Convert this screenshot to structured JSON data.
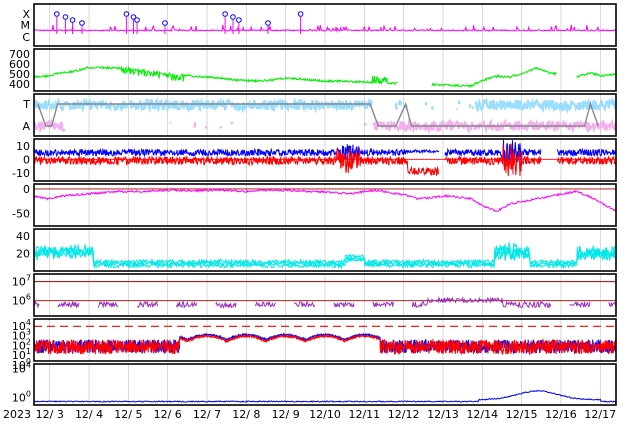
{
  "year_label": "2023",
  "x_dates": [
    "12/ 3",
    "12/ 4",
    "12/ 5",
    "12/ 6",
    "12/ 7",
    "12/ 8",
    "12/ 9",
    "12/10",
    "12/11",
    "12/12",
    "12/13",
    "12/14",
    "12/15",
    "12/16",
    "12/17"
  ],
  "colors": {
    "magenta": "#ff00ff",
    "green": "#00ee00",
    "lightblue": "#99ddff",
    "pink": "#f4b0ee",
    "gray": "#888888",
    "blue": "#0000ff",
    "red": "#ff0000",
    "purple": "#9b30b8",
    "cyan": "#00e8e8",
    "darkred": "#aa0000",
    "grid": "#c0c0c0"
  },
  "chart_data": [
    {
      "type": "line",
      "id": "xray-flare-class",
      "ytick_labels": [
        "X",
        "M",
        "C"
      ],
      "series": [
        {
          "color": "magenta"
        }
      ],
      "flare_markers": [
        3.18,
        3.4,
        3.58,
        3.82,
        4.95,
        5.13,
        5.22,
        5.93,
        7.46,
        7.66,
        7.81,
        8.55,
        9.38
      ]
    },
    {
      "type": "line",
      "id": "solar-wind-speed",
      "yticks": [
        400,
        500,
        600,
        700
      ],
      "ytick_labels": [
        "400",
        "500",
        "600",
        "700"
      ],
      "ylim": [
        330,
        750
      ],
      "series": [
        {
          "color": "green",
          "values": [
            470,
            480,
            510,
            525,
            560,
            565,
            560,
            555,
            540,
            520,
            505,
            490,
            480,
            470,
            460,
            445,
            435,
            430,
            440,
            460,
            450,
            440,
            430,
            430,
            425,
            420,
            415,
            410,
            405,
            400,
            395,
            390,
            385,
            380,
            440,
            480,
            470,
            510,
            560,
            510,
            490,
            470,
            510,
            480,
            500
          ]
        }
      ]
    },
    {
      "type": "line",
      "id": "imf-sector",
      "ytick_labels": [
        "T",
        "A"
      ],
      "series": [
        {
          "color": "lightblue"
        },
        {
          "color": "pink"
        },
        {
          "color": "gray"
        }
      ]
    },
    {
      "type": "line",
      "id": "imf-field",
      "yticks": [
        -10,
        0,
        10
      ],
      "ytick_labels": [
        "-10",
        "0",
        "10"
      ],
      "ylim": [
        -16,
        15
      ],
      "series": [
        {
          "color": "blue"
        },
        {
          "color": "red"
        }
      ]
    },
    {
      "type": "line",
      "id": "dst-index",
      "yticks": [
        -50,
        0
      ],
      "ytick_labels": [
        "-50",
        "0"
      ],
      "ylim": [
        -75,
        10
      ],
      "series": [
        {
          "color": "magenta",
          "values": [
            -15,
            -20,
            -15,
            -12,
            -10,
            -8,
            -6,
            -5,
            -5,
            -4,
            -3,
            -3,
            -4,
            -3,
            -2,
            -3,
            -5,
            -3,
            -2,
            -3,
            -4,
            -5,
            -6,
            -8,
            -10,
            -5,
            -3,
            -8,
            -12,
            -20,
            -18,
            -14,
            -16,
            -20,
            -35,
            -45,
            -30,
            -25,
            -20,
            -15,
            -10,
            -5,
            -15,
            -30,
            -45
          ]
        }
      ]
    },
    {
      "type": "line",
      "id": "kp-index",
      "yticks": [
        20,
        40
      ],
      "ytick_labels": [
        "20",
        "40"
      ],
      "ylim": [
        0,
        48
      ],
      "series": [
        {
          "color": "cyan"
        }
      ]
    },
    {
      "type": "line",
      "id": "electron-flux",
      "yticks": [
        6,
        7
      ],
      "ytick_labels": [
        "10^6",
        "10^7"
      ],
      "ylim": [
        5.2,
        7.4
      ],
      "series": [
        {
          "color": "purple"
        }
      ]
    },
    {
      "type": "line",
      "id": "proton-flux",
      "yticks": [
        0,
        1,
        2,
        3,
        4
      ],
      "ytick_labels": [
        "10^0",
        "10^1",
        "10^2",
        "10^3",
        "10^4"
      ],
      "ylim": [
        0.4,
        4.7
      ],
      "series": [
        {
          "color": "blue"
        },
        {
          "color": "red"
        }
      ]
    },
    {
      "type": "line",
      "id": "x-ray-background",
      "yticks": [
        0,
        4
      ],
      "ytick_labels": [
        "10^0",
        "10^4"
      ],
      "ylim": [
        -1,
        4.6
      ],
      "series": [
        {
          "color": "blue"
        }
      ]
    }
  ]
}
